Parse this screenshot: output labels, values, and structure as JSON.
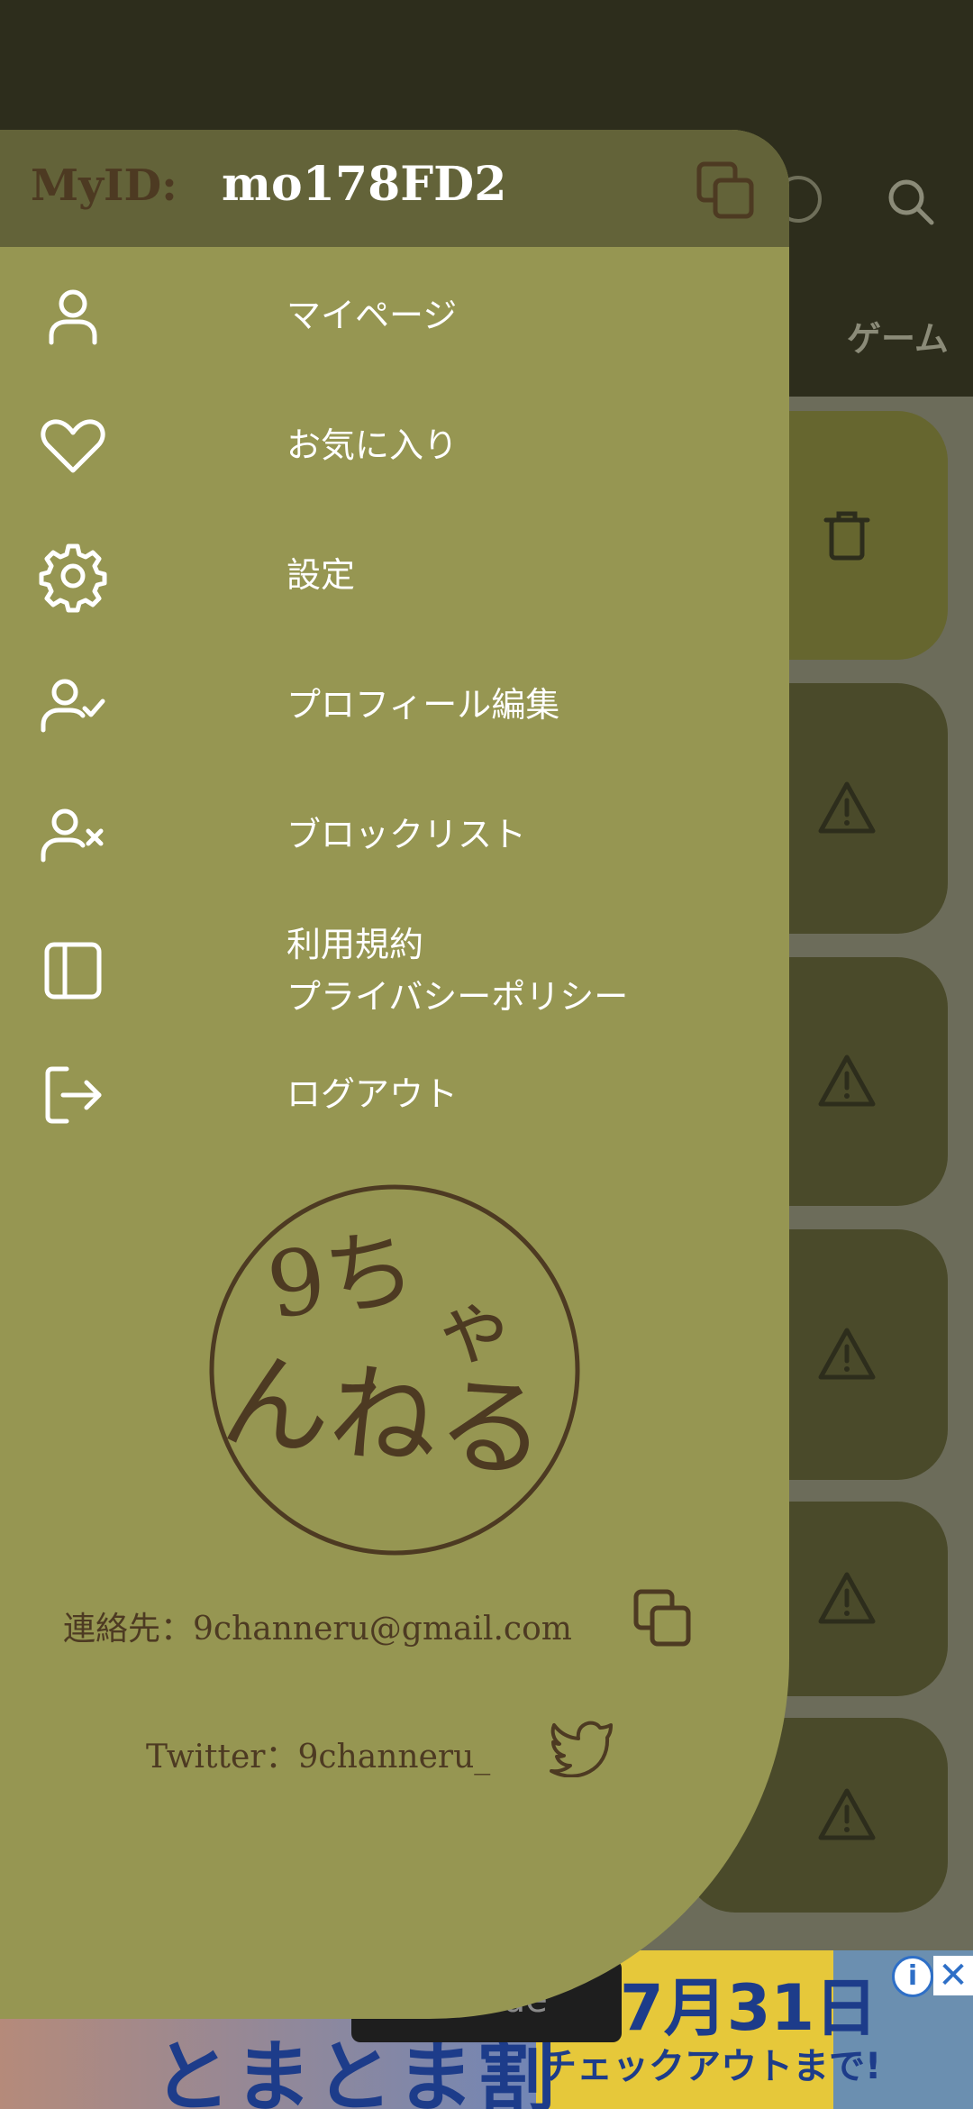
{
  "background": {
    "tab_label": "ゲーム"
  },
  "ad": {
    "headline": "とまとま割",
    "date": "7月31日",
    "sub": "チェックアウトまで!",
    "tooltip": "node",
    "info_icon": "info-icon",
    "close_icon": "close-icon"
  },
  "drawer": {
    "myid_label": "MyID:",
    "myid_value": "mo178FD2",
    "menu": [
      {
        "label": "マイページ",
        "icon": "user-icon"
      },
      {
        "label": "お気に入り",
        "icon": "heart-icon"
      },
      {
        "label": "設定",
        "icon": "gear-icon"
      },
      {
        "label": "プロフィール編集",
        "icon": "user-check-icon"
      },
      {
        "label": "ブロックリスト",
        "icon": "user-x-icon"
      },
      {
        "label_line1": "利用規約",
        "label_line2": "プライバシーポリシー",
        "icon": "sidebar-icon"
      },
      {
        "label": "ログアウト",
        "icon": "logout-icon"
      }
    ],
    "logo_text": "9ちゃんねる",
    "contact": "連絡先：9channeru@gmail.com",
    "twitter": "Twitter：9channeru_"
  },
  "colors": {
    "drawer_bg": "#969652",
    "drawer_header": "#636339",
    "accent_brown": "#4d3a22",
    "topbar": "#2d2d1c"
  }
}
